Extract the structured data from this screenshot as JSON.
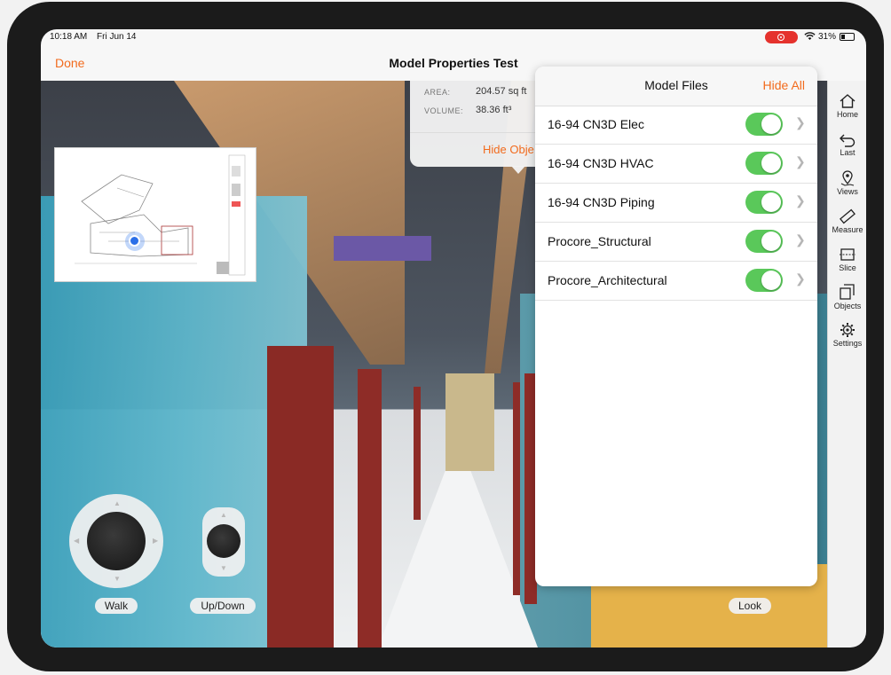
{
  "status_bar": {
    "time": "10:18 AM",
    "date": "Fri Jun 14",
    "battery": "31%"
  },
  "nav": {
    "done_label": "Done",
    "title": "Model Properties Test"
  },
  "properties": {
    "area_label": "AREA:",
    "area_value": "204.57 sq ft",
    "volume_label": "VOLUME:",
    "volume_value": "38.36 ft³",
    "hide_object_label": "Hide Obje"
  },
  "model_files": {
    "title": "Model Files",
    "hide_all_label": "Hide All",
    "items": [
      {
        "label": "16-94 CN3D Elec",
        "visible": true
      },
      {
        "label": "16-94 CN3D HVAC",
        "visible": true
      },
      {
        "label": "16-94 CN3D Piping",
        "visible": true
      },
      {
        "label": "Procore_Structural",
        "visible": true
      },
      {
        "label": "Procore_Architectural",
        "visible": true
      }
    ]
  },
  "toolbar": {
    "items": [
      {
        "label": "Home",
        "icon": "home-icon"
      },
      {
        "label": "Last",
        "icon": "undo-arrow-icon"
      },
      {
        "label": "Views",
        "icon": "map-pin-icon"
      },
      {
        "label": "Measure",
        "icon": "ruler-icon"
      },
      {
        "label": "Slice",
        "icon": "slice-icon"
      },
      {
        "label": "Objects",
        "icon": "objects-icon"
      },
      {
        "label": "Settings",
        "icon": "gear-icon"
      }
    ]
  },
  "controls": {
    "walk_label": "Walk",
    "updown_label": "Up/Down",
    "look_label": "Look"
  },
  "colors": {
    "accent": "#f26b1d",
    "toggle_on": "#5ac85a",
    "door_red": "#8a2a25"
  }
}
